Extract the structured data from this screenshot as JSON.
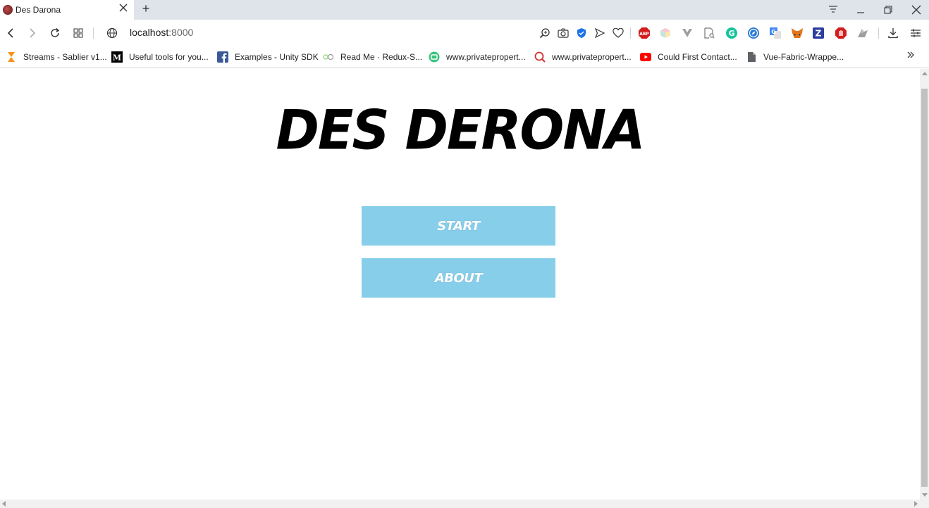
{
  "browser": {
    "tab": {
      "title": "Des Darona",
      "favicon": "globe-favicon-icon"
    },
    "new_tab_label": "+",
    "address": {
      "host": "localhost",
      "port": ":8000"
    },
    "bookmarks": [
      {
        "label": "Streams - Sablier v1...",
        "icon": "sablier-icon"
      },
      {
        "label": "Useful tools for you...",
        "icon": "medium-icon"
      },
      {
        "label": "Examples - Unity SDK",
        "icon": "facebook-icon"
      },
      {
        "label": "Read Me · Redux-S...",
        "icon": "redux-saga-icon"
      },
      {
        "label": "www.privatepropert...",
        "icon": "privateproperty-icon"
      },
      {
        "label": "www.privatepropert...",
        "icon": "privateproperty-search-icon"
      },
      {
        "label": "Could First Contact...",
        "icon": "youtube-icon"
      },
      {
        "label": "Vue-Fabric-Wrappe...",
        "icon": "document-icon"
      }
    ],
    "extensions": [
      "zoom-icon",
      "camera-icon",
      "shield-check-icon",
      "send-icon",
      "heart-icon",
      "adblock-plus-icon",
      "cube-icon",
      "vue-devtools-icon",
      "page-search-icon",
      "grammarly-icon",
      "compass-icon",
      "google-translate-icon",
      "metamask-icon",
      "z-icon",
      "stop-hand-icon",
      "puzzle-icon",
      "download-icon",
      "settings-icon"
    ],
    "colors": {
      "tabstrip": "#dfe3ea",
      "accent_blue": "#1a73e8"
    }
  },
  "page": {
    "title": "Des Derona",
    "buttons": {
      "start": "Start",
      "about": "About"
    },
    "colors": {
      "button_bg": "#87ceeb",
      "button_text": "#ffffff",
      "title": "#000000"
    }
  }
}
